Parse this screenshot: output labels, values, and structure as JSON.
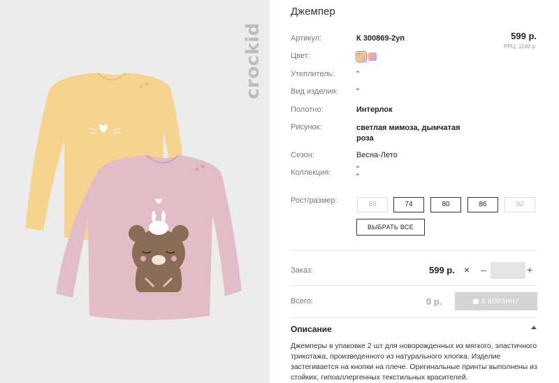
{
  "product": {
    "title": "Джемпер",
    "price": "599 р.",
    "rrc": "РРЦ: 1199 р.",
    "brand": "crockid",
    "colors": [
      {
        "name": "multi-1",
        "selected": true
      },
      {
        "name": "multi-2",
        "selected": false
      }
    ],
    "specs": [
      {
        "label": "Артикул:",
        "value": "К 300869-2уп"
      },
      {
        "label": "Цвет:",
        "value": ""
      },
      {
        "label": "Утеплитель:",
        "value": "\""
      },
      {
        "label": "Вид изделия:",
        "value": "\""
      },
      {
        "label": "Полотно:",
        "value": "Интерлок"
      },
      {
        "label": "Рисунок:",
        "value": "светлая мимоза, дымчатая роза"
      },
      {
        "label": "Сезон:",
        "value": "Весна-Лето"
      },
      {
        "label": "Коллекция:",
        "value": "\"\n\""
      },
      {
        "label": "Рост/размер:",
        "value": ""
      }
    ],
    "sizes": [
      {
        "label": "68",
        "available": false
      },
      {
        "label": "74",
        "available": true
      },
      {
        "label": "80",
        "available": true
      },
      {
        "label": "86",
        "available": true
      },
      {
        "label": "92",
        "available": false
      }
    ],
    "select_all": "ВЫБРАТЬ ВСЕ"
  },
  "order": {
    "label": "Заказ:",
    "price": "599 р.",
    "times": "×",
    "minus": "–",
    "plus": "+",
    "quantity": ""
  },
  "total": {
    "label": "Всего:",
    "value": "0 р.",
    "cart_button": "В КОРЗИНУ"
  },
  "description": {
    "heading": "Описание",
    "text": "Джемперы в упаковке 2 шт для новорожденных из мягкого, эластичного трикотажа, произведенного из натурального хлопка. Изделие застегивается на кнопки на плече. Оригинальные принты выполнены из стойких, гипоаллергенных текстильных красителей."
  },
  "colors": {
    "photo_bg": "#ececec",
    "yellow_shirt": "#f6d490",
    "pink_shirt": "#e2bcc6",
    "bear": "#8a6d55",
    "button_disabled": "#d4d4d4"
  }
}
